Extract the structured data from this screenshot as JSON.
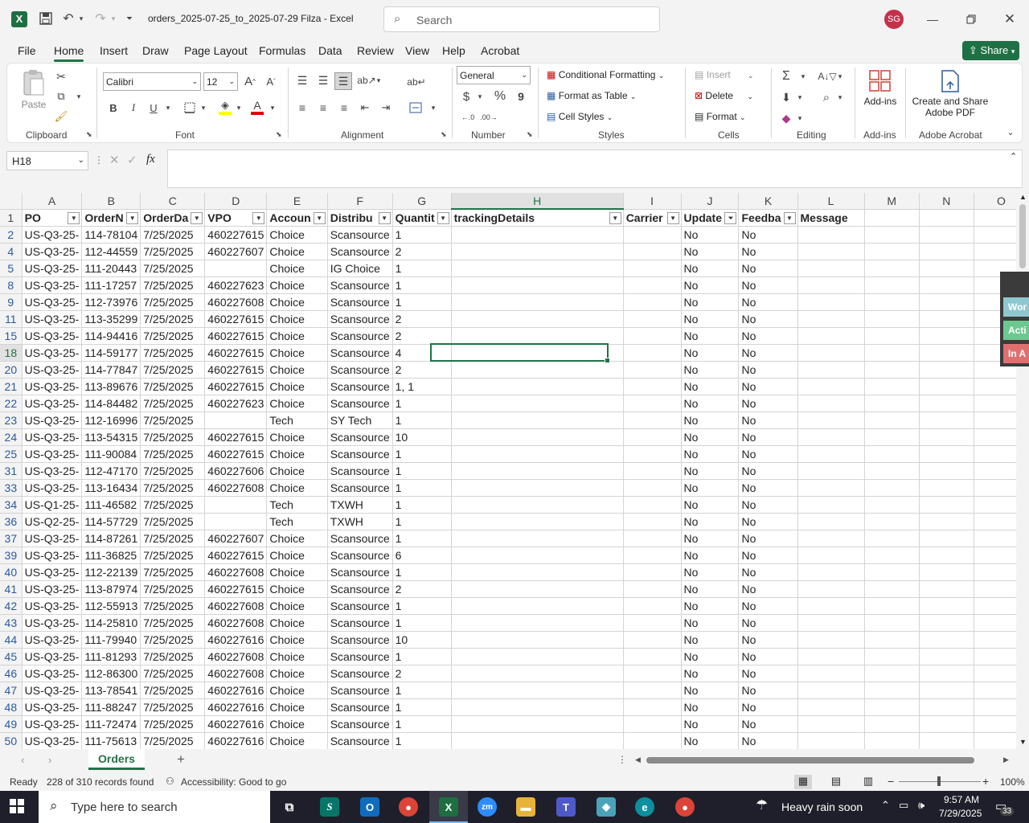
{
  "window": {
    "file_title": "orders_2025-07-25_to_2025-07-29 Filza",
    "app_name": "Excel",
    "search_placeholder": "Search",
    "user_initials": "SG"
  },
  "ribbon_tabs": [
    "File",
    "Home",
    "Insert",
    "Draw",
    "Page Layout",
    "Formulas",
    "Data",
    "Review",
    "View",
    "Help",
    "Acrobat"
  ],
  "share_label": "Share",
  "ribbon": {
    "clipboard": {
      "paste": "Paste",
      "label": "Clipboard"
    },
    "font": {
      "name": "Calibri",
      "size": "12",
      "label": "Font",
      "bold": "B",
      "italic": "I",
      "underline": "U"
    },
    "alignment": {
      "label": "Alignment"
    },
    "number": {
      "format": "General",
      "currency": "$",
      "percent": "%",
      "comma": "9",
      "label": "Number"
    },
    "styles": {
      "conditional": "Conditional Formatting",
      "format_table": "Format as Table",
      "cell_styles": "Cell Styles",
      "label": "Styles"
    },
    "cells": {
      "insert": "Insert",
      "delete": "Delete",
      "format": "Format",
      "label": "Cells"
    },
    "editing": {
      "label": "Editing"
    },
    "addins": {
      "button": "Add-ins",
      "label": "Add-ins"
    },
    "acrobat": {
      "button_line1": "Create and Share",
      "button_line2": "Adobe PDF",
      "label": "Adobe Acrobat"
    }
  },
  "formula_bar": {
    "name_box": "H18",
    "fx": "fx",
    "content": ""
  },
  "columns": [
    "A",
    "B",
    "C",
    "D",
    "E",
    "F",
    "G",
    "H",
    "I",
    "J",
    "K",
    "L",
    "M",
    "N",
    "O"
  ],
  "headers": [
    "PO",
    "OrderN",
    "OrderDa",
    "VPO",
    "Accoun",
    "Distribu",
    "Quantit",
    "trackingDetails",
    "Carrier",
    "Update",
    "Feedba",
    "Message"
  ],
  "rows": [
    {
      "n": "2",
      "c": [
        "US-Q3-25-",
        "114-78104",
        "7/25/2025",
        "460227615",
        "Choice",
        "Scansource",
        "1",
        "",
        "",
        "No",
        "No",
        ""
      ]
    },
    {
      "n": "4",
      "c": [
        "US-Q3-25-",
        "112-44559",
        "7/25/2025",
        "460227607",
        "Choice",
        "Scansource",
        "2",
        "",
        "",
        "No",
        "No",
        ""
      ]
    },
    {
      "n": "5",
      "c": [
        "US-Q3-25-",
        "111-20443",
        "7/25/2025",
        "",
        "Choice",
        "IG Choice",
        "1",
        "",
        "",
        "No",
        "No",
        ""
      ]
    },
    {
      "n": "8",
      "c": [
        "US-Q3-25-",
        "111-17257",
        "7/25/2025",
        "460227623",
        "Choice",
        "Scansource",
        "1",
        "",
        "",
        "No",
        "No",
        ""
      ]
    },
    {
      "n": "9",
      "c": [
        "US-Q3-25-",
        "112-73976",
        "7/25/2025",
        "460227608",
        "Choice",
        "Scansource",
        "1",
        "",
        "",
        "No",
        "No",
        ""
      ]
    },
    {
      "n": "11",
      "c": [
        "US-Q3-25-",
        "113-35299",
        "7/25/2025",
        "460227615",
        "Choice",
        "Scansource",
        "2",
        "",
        "",
        "No",
        "No",
        ""
      ]
    },
    {
      "n": "15",
      "c": [
        "US-Q3-25-",
        "114-94416",
        "7/25/2025",
        "460227615",
        "Choice",
        "Scansource",
        "2",
        "",
        "",
        "No",
        "No",
        ""
      ]
    },
    {
      "n": "18",
      "c": [
        "US-Q3-25-",
        "114-59177",
        "7/25/2025",
        "460227615",
        "Choice",
        "Scansource",
        "4",
        "",
        "",
        "No",
        "No",
        ""
      ]
    },
    {
      "n": "20",
      "c": [
        "US-Q3-25-",
        "114-77847",
        "7/25/2025",
        "460227615",
        "Choice",
        "Scansource",
        "2",
        "",
        "",
        "No",
        "No",
        ""
      ]
    },
    {
      "n": "21",
      "c": [
        "US-Q3-25-",
        "113-89676",
        "7/25/2025",
        "460227615",
        "Choice",
        "Scansource",
        "1, 1",
        "",
        "",
        "No",
        "No",
        ""
      ]
    },
    {
      "n": "22",
      "c": [
        "US-Q3-25-",
        "114-84482",
        "7/25/2025",
        "460227623",
        "Choice",
        "Scansource",
        "1",
        "",
        "",
        "No",
        "No",
        ""
      ]
    },
    {
      "n": "23",
      "c": [
        "US-Q3-25-",
        "112-16996",
        "7/25/2025",
        "",
        "Tech",
        "SY Tech",
        "1",
        "",
        "",
        "No",
        "No",
        ""
      ]
    },
    {
      "n": "24",
      "c": [
        "US-Q3-25-",
        "113-54315",
        "7/25/2025",
        "460227615",
        "Choice",
        "Scansource",
        "10",
        "",
        "",
        "No",
        "No",
        ""
      ]
    },
    {
      "n": "25",
      "c": [
        "US-Q3-25-",
        "111-90084",
        "7/25/2025",
        "460227615",
        "Choice",
        "Scansource",
        "1",
        "",
        "",
        "No",
        "No",
        ""
      ]
    },
    {
      "n": "31",
      "c": [
        "US-Q3-25-",
        "112-47170",
        "7/25/2025",
        "460227606",
        "Choice",
        "Scansource",
        "1",
        "",
        "",
        "No",
        "No",
        ""
      ]
    },
    {
      "n": "33",
      "c": [
        "US-Q3-25-",
        "113-16434",
        "7/25/2025",
        "460227608",
        "Choice",
        "Scansource",
        "1",
        "",
        "",
        "No",
        "No",
        ""
      ]
    },
    {
      "n": "34",
      "c": [
        "US-Q1-25-",
        "111-46582",
        "7/25/2025",
        "",
        "Tech",
        "TXWH",
        "1",
        "",
        "",
        "No",
        "No",
        ""
      ]
    },
    {
      "n": "36",
      "c": [
        "US-Q2-25-",
        "114-57729",
        "7/25/2025",
        "",
        "Tech",
        "TXWH",
        "1",
        "",
        "",
        "No",
        "No",
        ""
      ]
    },
    {
      "n": "37",
      "c": [
        "US-Q3-25-",
        "114-87261",
        "7/25/2025",
        "460227607",
        "Choice",
        "Scansource",
        "1",
        "",
        "",
        "No",
        "No",
        ""
      ]
    },
    {
      "n": "39",
      "c": [
        "US-Q3-25-",
        "111-36825",
        "7/25/2025",
        "460227615",
        "Choice",
        "Scansource",
        "6",
        "",
        "",
        "No",
        "No",
        ""
      ]
    },
    {
      "n": "40",
      "c": [
        "US-Q3-25-",
        "112-22139",
        "7/25/2025",
        "460227608",
        "Choice",
        "Scansource",
        "1",
        "",
        "",
        "No",
        "No",
        ""
      ]
    },
    {
      "n": "41",
      "c": [
        "US-Q3-25-",
        "113-87974",
        "7/25/2025",
        "460227615",
        "Choice",
        "Scansource",
        "2",
        "",
        "",
        "No",
        "No",
        ""
      ]
    },
    {
      "n": "42",
      "c": [
        "US-Q3-25-",
        "112-55913",
        "7/25/2025",
        "460227608",
        "Choice",
        "Scansource",
        "1",
        "",
        "",
        "No",
        "No",
        ""
      ]
    },
    {
      "n": "43",
      "c": [
        "US-Q3-25-",
        "114-25810",
        "7/25/2025",
        "460227608",
        "Choice",
        "Scansource",
        "1",
        "",
        "",
        "No",
        "No",
        ""
      ]
    },
    {
      "n": "44",
      "c": [
        "US-Q3-25-",
        "111-79940",
        "7/25/2025",
        "460227616",
        "Choice",
        "Scansource",
        "10",
        "",
        "",
        "No",
        "No",
        ""
      ]
    },
    {
      "n": "45",
      "c": [
        "US-Q3-25-",
        "111-81293",
        "7/25/2025",
        "460227608",
        "Choice",
        "Scansource",
        "1",
        "",
        "",
        "No",
        "No",
        ""
      ]
    },
    {
      "n": "46",
      "c": [
        "US-Q3-25-",
        "112-86300",
        "7/25/2025",
        "460227608",
        "Choice",
        "Scansource",
        "2",
        "",
        "",
        "No",
        "No",
        ""
      ]
    },
    {
      "n": "47",
      "c": [
        "US-Q3-25-",
        "113-78541",
        "7/25/2025",
        "460227616",
        "Choice",
        "Scansource",
        "1",
        "",
        "",
        "No",
        "No",
        ""
      ]
    },
    {
      "n": "48",
      "c": [
        "US-Q3-25-",
        "111-88247",
        "7/25/2025",
        "460227616",
        "Choice",
        "Scansource",
        "1",
        "",
        "",
        "No",
        "No",
        ""
      ]
    },
    {
      "n": "49",
      "c": [
        "US-Q3-25-",
        "111-72474",
        "7/25/2025",
        "460227616",
        "Choice",
        "Scansource",
        "1",
        "",
        "",
        "No",
        "No",
        ""
      ]
    },
    {
      "n": "50",
      "c": [
        "US-Q3-25-",
        "111-75613",
        "7/25/2025",
        "460227616",
        "Choice",
        "Scansource",
        "1",
        "",
        "",
        "No",
        "No",
        ""
      ]
    }
  ],
  "side_panel": [
    "Wor",
    "Acti",
    "In A"
  ],
  "sheet_tab": "Orders",
  "status": {
    "ready": "Ready",
    "records": "228 of 310 records found",
    "accessibility": "Accessibility: Good to go",
    "zoom": "100%"
  },
  "taskbar": {
    "search_placeholder": "Type here to search",
    "weather": "Heavy rain soon",
    "time": "9:57 AM",
    "date": "7/29/2025",
    "notifications": "33"
  }
}
